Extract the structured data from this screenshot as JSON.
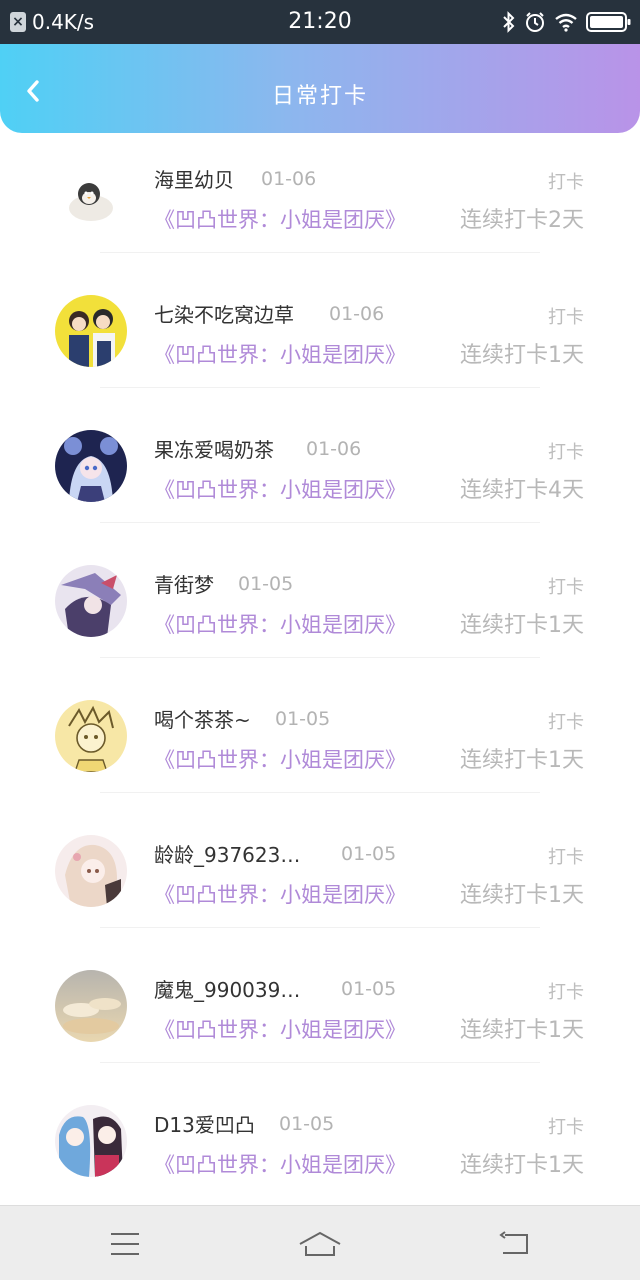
{
  "status_bar": {
    "speed": "0.4K/s",
    "time": "21:20",
    "icons": [
      "x-notification-icon",
      "bluetooth-icon",
      "alarm-icon",
      "wifi-icon",
      "battery-icon"
    ]
  },
  "header": {
    "title": "日常打卡",
    "back_icon": "back-chevron-icon",
    "gradient_colors": [
      "#4fd0f5",
      "#b993e8"
    ]
  },
  "entries": [
    {
      "name": "海里幼贝",
      "date": "01-06",
      "action": "打卡",
      "world": "《凹凸世界：小姐是团厌》",
      "streak": "连续打卡2天"
    },
    {
      "name": "七染不吃窝边草",
      "date": "01-06",
      "action": "打卡",
      "world": "《凹凸世界：小姐是团厌》",
      "streak": "连续打卡1天"
    },
    {
      "name": "果冻爱喝奶茶",
      "date": "01-06",
      "action": "打卡",
      "world": "《凹凸世界：小姐是团厌》",
      "streak": "连续打卡4天"
    },
    {
      "name": "青街梦",
      "date": "01-05",
      "action": "打卡",
      "world": "《凹凸世界：小姐是团厌》",
      "streak": "连续打卡1天"
    },
    {
      "name": "喝个茶茶~",
      "date": "01-05",
      "action": "打卡",
      "world": "《凹凸世界：小姐是团厌》",
      "streak": "连续打卡1天"
    },
    {
      "name": "龄龄_937623…",
      "date": "01-05",
      "action": "打卡",
      "world": "《凹凸世界：小姐是团厌》",
      "streak": "连续打卡1天"
    },
    {
      "name": "魔鬼_990039…",
      "date": "01-05",
      "action": "打卡",
      "world": "《凹凸世界：小姐是团厌》",
      "streak": "连续打卡1天"
    },
    {
      "name": "D13爱凹凸",
      "date": "01-05",
      "action": "打卡",
      "world": "《凹凸世界：小姐是团厌》",
      "streak": "连续打卡1天"
    }
  ],
  "nav_bar": {
    "icons": [
      "menu-icon",
      "home-icon",
      "back-icon"
    ]
  },
  "colors": {
    "accent_purple": "#b08ad8",
    "status_bar_bg": "#27323d"
  }
}
